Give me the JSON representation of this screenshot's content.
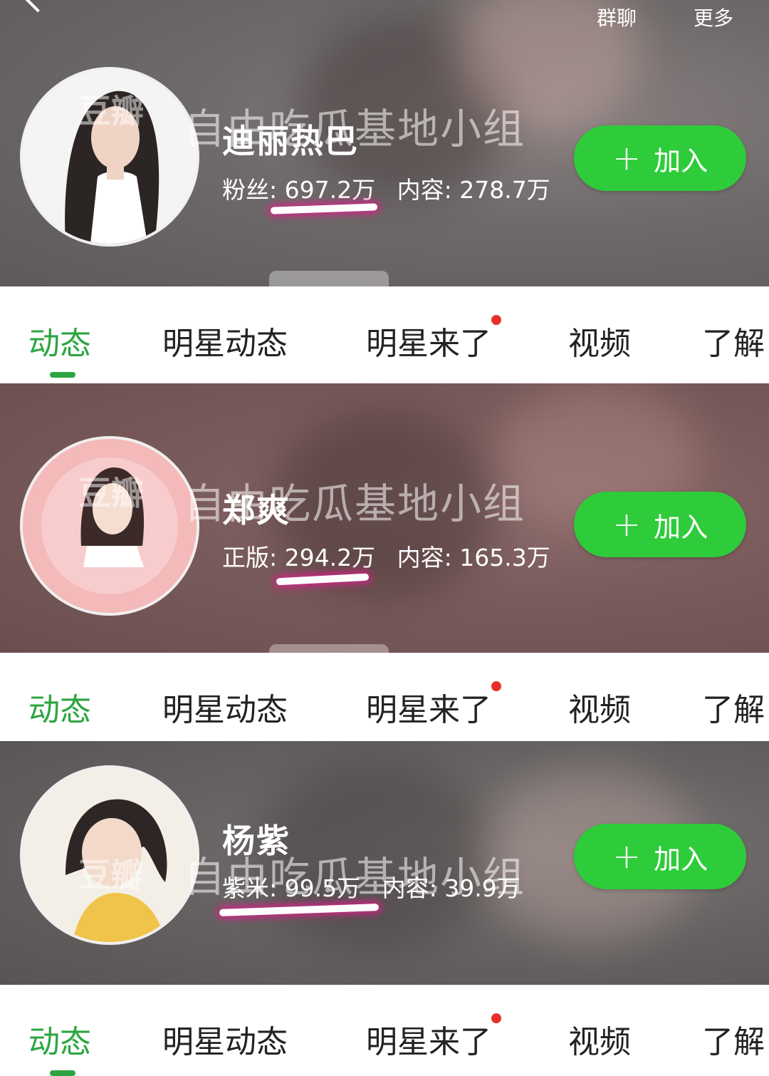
{
  "topbar": {
    "group_chat": "群聊",
    "more": "更多"
  },
  "watermark": {
    "text": "自由吃瓜基地小组",
    "box": "豆瓣"
  },
  "join_label": "加入",
  "join_plus": "+",
  "cards": [
    {
      "name": "迪丽热巴",
      "fans_label": "粉丝:",
      "fans_value": "697.2万",
      "content_label": "内容:",
      "content_value": "278.7万"
    },
    {
      "name": "郑爽",
      "fans_label": "正版:",
      "fans_value": "294.2万",
      "content_label": "内容:",
      "content_value": "165.3万"
    },
    {
      "name": "杨紫",
      "fans_label": "紫米:",
      "fans_value": "99.5万",
      "content_label": "内容:",
      "content_value": "39.9万"
    }
  ],
  "tabs": [
    "动态",
    "明星动态",
    "明星来了",
    "视频",
    "了解"
  ],
  "colors": {
    "accent_green": "#2ca540",
    "button_green": "#2ecc3a",
    "badge_red": "#e8302a",
    "underline_glow": "#dc1e8c"
  }
}
